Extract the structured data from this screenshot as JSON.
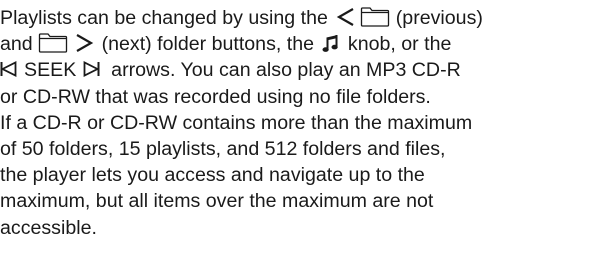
{
  "paragraph": {
    "line1": {
      "before": "Playlists can be changed by using the",
      "after": "(previous)"
    },
    "line2": {
      "before": "and",
      "mid": "(next) folder buttons, the",
      "after": "knob, or the"
    },
    "line3": {
      "seek": "SEEK",
      "after": "arrows. You can also play an MP3 CD-R"
    },
    "line4": "or CD-RW that was recorded using no file folders.",
    "line5": "If a CD-R or CD-RW contains more than the maximum",
    "line6": "of 50 folders, 15 playlists, and 512 folders and files,",
    "line7": "the player lets you access and navigate up to the",
    "line8": "maximum, but all items over the maximum are not",
    "line9": "accessible."
  },
  "icons": {
    "previous_chevron": "chevron-left-icon",
    "previous_folder": "folder-icon",
    "next_folder": "folder-icon",
    "next_chevron": "chevron-right-icon",
    "knob": "music-note-icon",
    "seek_back": "seek-back-icon",
    "seek_forward": "seek-forward-icon"
  }
}
